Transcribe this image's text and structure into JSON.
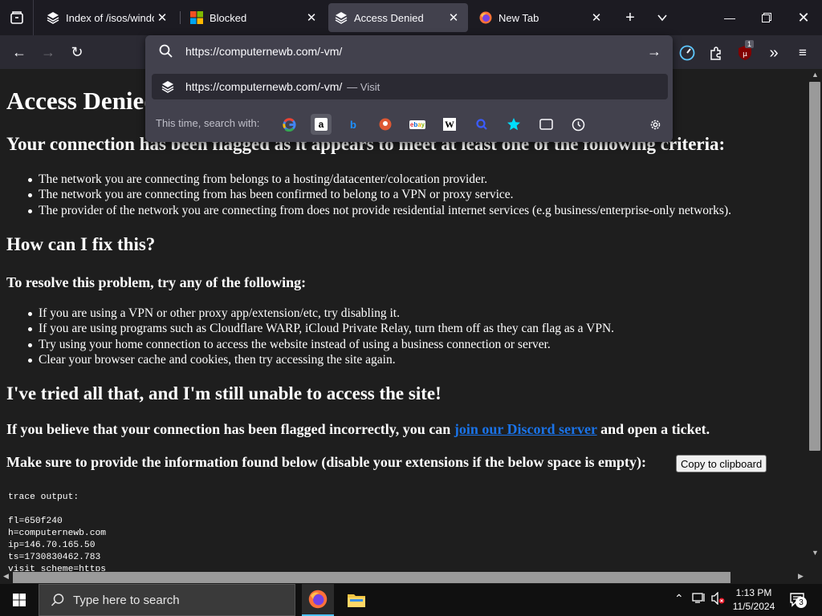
{
  "browser": {
    "tabs": [
      {
        "title": "Index of /isos/windows/",
        "favicon": "stack-icon"
      },
      {
        "title": "Blocked",
        "favicon": "microsoft-logo-icon"
      },
      {
        "title": "Access Denied",
        "favicon": "stack-icon"
      },
      {
        "title": "New Tab",
        "favicon": "firefox-icon"
      }
    ],
    "active_tab": 2,
    "url": "https://computernewb.com/-vm/",
    "suggestion": {
      "url": "https://computernewb.com/-vm/",
      "action": "— Visit"
    },
    "search_with_label": "This time, search with:",
    "engines": [
      "google",
      "amazon",
      "bing",
      "duckduckgo",
      "ebay",
      "wikipedia",
      "search",
      "bookmarks",
      "tabs",
      "history"
    ],
    "extension_badge": "1"
  },
  "page": {
    "title": "Access Denied",
    "heading_criteria": "Your connection has been flagged as it appears to meet at least one of the following criteria:",
    "criteria": [
      "The network you are connecting from belongs to a hosting/datacenter/colocation provider.",
      "The network you are connecting from has been confirmed to belong to a VPN or proxy service.",
      "The provider of the network you are connecting from does not provide residential internet services (e.g business/enterprise-only networks)."
    ],
    "heading_fix": "How can I fix this?",
    "resolve_label": "To resolve this problem, try any of the following:",
    "fixes": [
      "If you are using a VPN or other proxy app/extension/etc, try disabling it.",
      "If you are using programs such as Cloudflare WARP, iCloud Private Relay, turn them off as they can flag as a VPN.",
      "Try using your home connection to access the website instead of using a business connection or server.",
      "Clear your browser cache and cookies, then try accessing the site again."
    ],
    "heading_tried": "I've tried all that, and I'm still unable to access the site!",
    "discord_pre": "If you believe that your connection has been flagged incorrectly, you can ",
    "discord_link": "join our Discord server",
    "discord_post": " and open a ticket.",
    "provide_label": "Make sure to provide the information found below (disable your extensions if the below space is empty):",
    "copy_button": "Copy to clipboard",
    "trace": "trace output:\n\nfl=650f240\nh=computernewb.com\nip=146.70.165.50\nts=1730830462.783\nvisit_scheme=https"
  },
  "taskbar": {
    "search_placeholder": "Type here to search",
    "time": "1:13 PM",
    "date": "11/5/2024",
    "notification_count": "3"
  },
  "colors": {
    "link": "#1a73e8",
    "page_bg": "#1e1e1e",
    "toolbar_bg": "#2b2a33",
    "active_tab": "#42414d"
  }
}
